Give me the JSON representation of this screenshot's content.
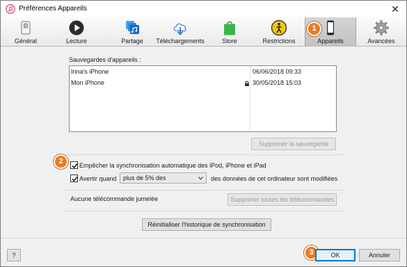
{
  "window": {
    "title": "Préférences Appareils"
  },
  "toolbar": {
    "items": [
      {
        "label": "Général",
        "icon": "general-switch-icon"
      },
      {
        "label": "Lecture",
        "icon": "play-icon"
      },
      {
        "label": "Partage",
        "icon": "sharing-icon"
      },
      {
        "label": "Téléchargements",
        "icon": "cloud-download-icon"
      },
      {
        "label": "Store",
        "icon": "store-bag-icon"
      },
      {
        "label": "Restrictions",
        "icon": "restrictions-icon"
      },
      {
        "label": "Appareils",
        "icon": "iphone-icon",
        "selected": true
      },
      {
        "label": "Avancées",
        "icon": "gear-icon"
      }
    ]
  },
  "badges": {
    "one": "1",
    "two": "2",
    "three": "3"
  },
  "backups": {
    "heading": "Sauvegardes d'appareils :",
    "rows": [
      {
        "name": "Irina's iPhone",
        "date": "06/06/2018 09:33",
        "locked": false
      },
      {
        "name": "Mon iPhone",
        "date": "30/05/2018 15:03",
        "locked": true
      }
    ],
    "delete_button": "Supprimer la sauvegarde"
  },
  "options": {
    "prevent_sync_label": "Empêcher la synchronisation automatique des iPod, iPhone et iPad",
    "prevent_sync_checked": true,
    "warn_label": "Avertir quand",
    "warn_checked": true,
    "warn_select_value": "plus de 5% des",
    "warn_suffix": "des données de cet ordinateur sont modifiées"
  },
  "remotes": {
    "status": "Aucune télécommande jumelée",
    "remove_button": "Supprimer toutes les télécommandes"
  },
  "reset_button": "Réinitialiser l'historique de synchronisation",
  "footer": {
    "help": "?",
    "ok": "OK",
    "cancel": "Annuler"
  },
  "colors": {
    "badge": "#ea7a23",
    "focus_blue": "#0078d7",
    "store_green": "#3cb44a",
    "restrictions_yellow": "#f2c511"
  }
}
